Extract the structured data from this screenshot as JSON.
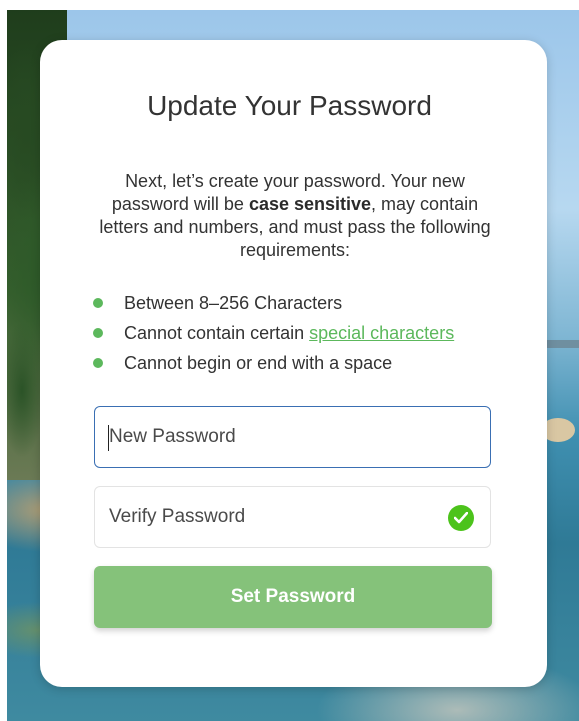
{
  "card": {
    "title": "Update Your Password",
    "intro_part1": "Next, let’s create your password. Your new password will be ",
    "intro_bold": "case sensitive",
    "intro_part2": ", may contain letters and numbers, and must pass the following requirements:"
  },
  "requirements": [
    {
      "text": "Between 8–256 Characters"
    },
    {
      "text": "Cannot contain certain ",
      "link": "special characters"
    },
    {
      "text": "Cannot begin or end with a space"
    }
  ],
  "fields": {
    "new_password_placeholder": "New Password",
    "verify_password_placeholder": "Verify Password"
  },
  "colors": {
    "accent_green": "#5cb85c",
    "button_green": "#85c27a",
    "focus_blue": "#3a6fb3",
    "check_green": "#4cc31b"
  },
  "icons": {
    "verify_status": "check-circle-icon"
  },
  "button": {
    "label": "Set Password"
  }
}
